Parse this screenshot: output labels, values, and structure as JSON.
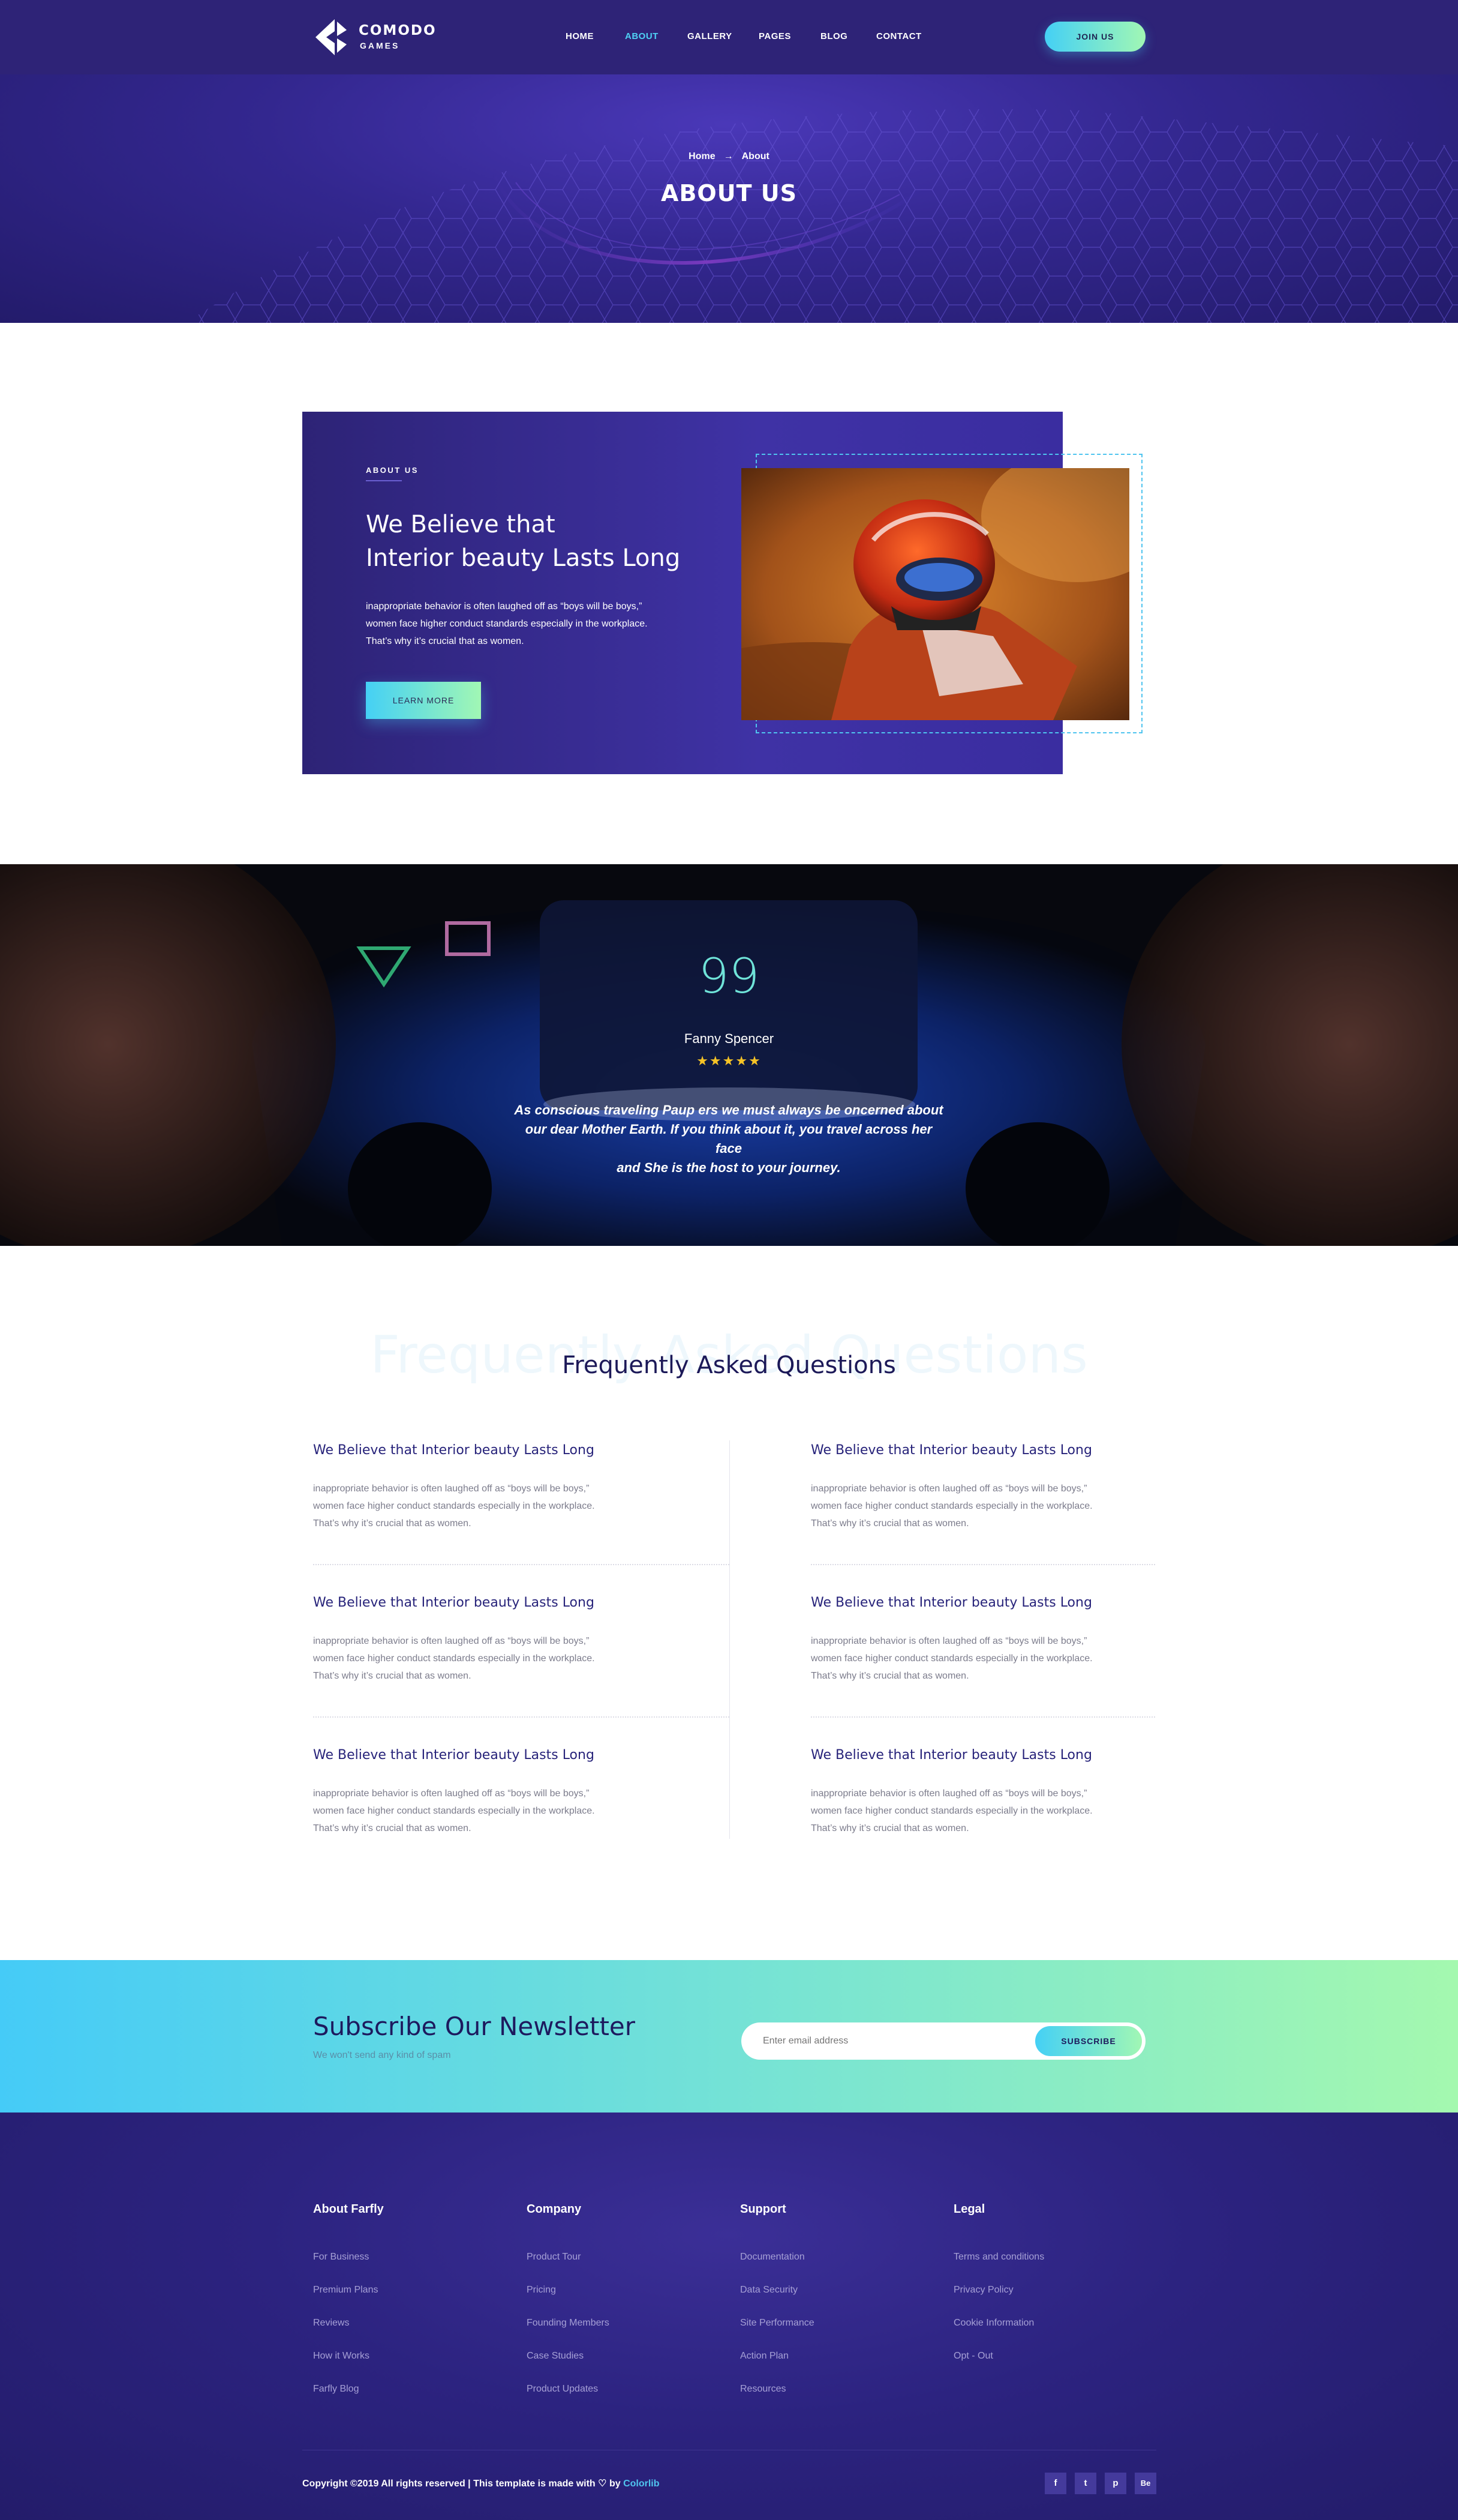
{
  "header": {
    "logo_line1": "COMODO",
    "logo_line2": "GAMES",
    "nav": [
      "HOME",
      "ABOUT",
      "GALLERY",
      "PAGES",
      "BLOG",
      "CONTACT"
    ],
    "active_nav": "ABOUT",
    "join_label": "JOIN US"
  },
  "banner": {
    "crumb_home": "Home",
    "crumb_arrow": "→",
    "crumb_current": "About",
    "title": "ABOUT US"
  },
  "about": {
    "label": "ABOUT US",
    "heading": [
      "We Believe that",
      "Interior beauty Lasts Long"
    ],
    "text": [
      "inappropriate behavior is often laughed off as “boys will be boys,”",
      "women face higher conduct standards especially in the workplace.",
      "That’s why it’s crucial that as women."
    ],
    "button_label": "LEARN MORE"
  },
  "testimonial": {
    "quote_mark": "99",
    "name": "Fanny Spencer",
    "stars": "★★★★★",
    "rating": 5,
    "quote": [
      "As conscious traveling Paup ers we must always be oncerned about",
      "our dear Mother Earth. If you think about it, you travel across her face",
      "and She is the host to your journey."
    ]
  },
  "faq": {
    "watermark": "Frequently Asked Questions",
    "title": "Frequently Asked Questions",
    "items": [
      {
        "q": "We Believe that Interior beauty Lasts Long",
        "a": [
          "inappropriate behavior is often laughed off as “boys will be boys,”",
          "women face higher conduct standards especially in the workplace.",
          "That’s why it’s crucial that as women."
        ]
      },
      {
        "q": "We Believe that Interior beauty Lasts Long",
        "a": [
          "inappropriate behavior is often laughed off as “boys will be boys,”",
          "women face higher conduct standards especially in the workplace.",
          "That’s why it’s crucial that as women."
        ]
      },
      {
        "q": "We Believe that Interior beauty Lasts Long",
        "a": [
          "inappropriate behavior is often laughed off as “boys will be boys,”",
          "women face higher conduct standards especially in the workplace.",
          "That’s why it’s crucial that as women."
        ]
      },
      {
        "q": "We Believe that Interior beauty Lasts Long",
        "a": [
          "inappropriate behavior is often laughed off as “boys will be boys,”",
          "women face higher conduct standards especially in the workplace.",
          "That’s why it’s crucial that as women."
        ]
      },
      {
        "q": "We Believe that Interior beauty Lasts Long",
        "a": [
          "inappropriate behavior is often laughed off as “boys will be boys,”",
          "women face higher conduct standards especially in the workplace.",
          "That’s why it’s crucial that as women."
        ]
      },
      {
        "q": "We Believe that Interior beauty Lasts Long",
        "a": [
          "inappropriate behavior is often laughed off as “boys will be boys,”",
          "women face higher conduct standards especially in the workplace.",
          "That’s why it’s crucial that as women."
        ]
      }
    ]
  },
  "newsletter": {
    "title": "Subscribe Our Newsletter",
    "subtitle": "We won't send any kind of spam",
    "placeholder": "Enter email address",
    "button_label": "SUBSCRIBE"
  },
  "footer": {
    "columns": [
      {
        "title": "About Farfly",
        "links": [
          "For Business",
          "Premium Plans",
          "Reviews",
          "How it Works",
          "Farfly Blog"
        ]
      },
      {
        "title": "Company",
        "links": [
          "Product Tour",
          "Pricing",
          "Founding Members",
          "Case Studies",
          "Product Updates"
        ]
      },
      {
        "title": "Support",
        "links": [
          "Documentation",
          "Data Security",
          "Site Performance",
          "Action Plan",
          "Resources"
        ]
      },
      {
        "title": "Legal",
        "links": [
          "Terms and conditions",
          "Privacy Policy",
          "Cookie Information",
          "Opt - Out"
        ]
      }
    ],
    "copyright_prefix": "Copyright ©2019 All rights reserved | This template is made with",
    "heart": "♡",
    "by": "by",
    "brand": "Colorlib",
    "social": [
      "f",
      "t",
      "p",
      "Be"
    ]
  },
  "colors": {
    "header_bg": "#2e2377",
    "accent_cyan": "#44d0f5",
    "accent_green": "#a1f7b4",
    "heading_navy": "#1c1958",
    "star_yellow": "#f6c326"
  },
  "icons": {
    "logo": "play-triangle-logo-icon",
    "crumb_arrow": "arrow-right-icon",
    "quote": "quote-icon",
    "star": "star-icon",
    "heart": "heart-icon",
    "social": [
      "facebook-icon",
      "twitter-icon",
      "dribbble-icon",
      "behance-icon"
    ]
  }
}
